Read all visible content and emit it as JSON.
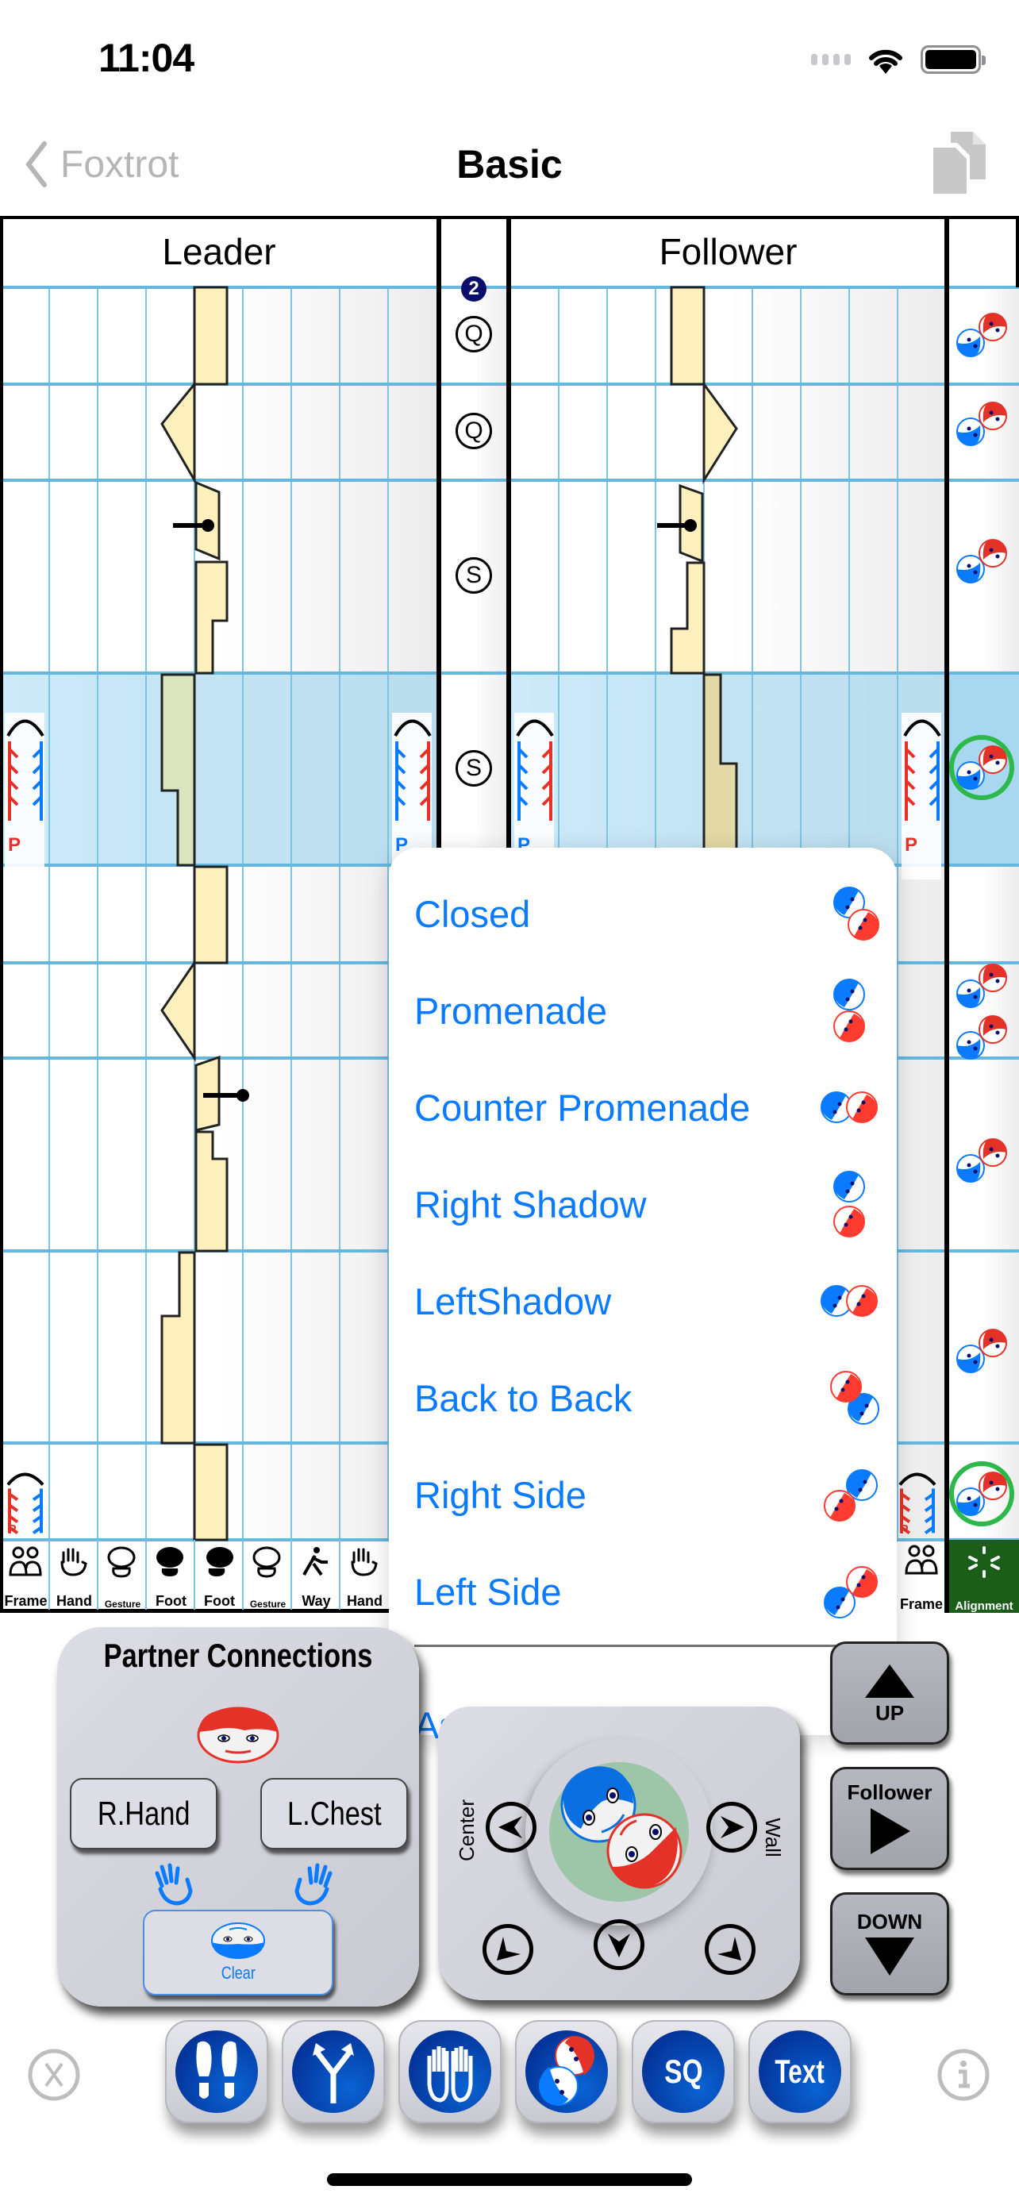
{
  "status_bar": {
    "time": "11:04",
    "battery_percent": 100
  },
  "nav": {
    "back_label": "Foxtrot",
    "title": "Basic",
    "right_icon": "copy-document-icon"
  },
  "chart": {
    "headers": {
      "leader": "Leader",
      "follower": "Follower"
    },
    "bar_number": "2",
    "counts": [
      "Q",
      "Q",
      "S",
      "S"
    ],
    "leader_icon_row": [
      {
        "label": "Frame",
        "icon": "frame-icon"
      },
      {
        "label": "Hand",
        "icon": "hand-icon"
      },
      {
        "label": "Gesture",
        "icon": "gesture-icon"
      },
      {
        "label": "Foot",
        "icon": "left-foot-icon"
      },
      {
        "label": "Foot",
        "icon": "right-foot-icon"
      },
      {
        "label": "Gesture",
        "icon": "gesture-icon"
      },
      {
        "label": "Way",
        "icon": "walking-icon"
      },
      {
        "label": "Hand",
        "icon": "hand-icon"
      }
    ],
    "follower_icon_row": [
      {
        "label": "Frame",
        "icon": "frame-icon"
      },
      {
        "label": "Alignment",
        "icon": "alignment-icon"
      }
    ],
    "frame_marker": "P",
    "colors": {
      "grid": "#7cc4e4",
      "step_fill": "#fdf0bd",
      "highlight_row": "#cdeaf9",
      "alignment_active": "#1a5e1a"
    }
  },
  "popover": {
    "items": [
      {
        "label": "Closed",
        "icon": "closed-position-icon"
      },
      {
        "label": "Promenade",
        "icon": "promenade-position-icon"
      },
      {
        "label": "Counter Promenade",
        "icon": "counter-promenade-position-icon"
      },
      {
        "label": "Right Shadow",
        "icon": "right-shadow-position-icon"
      },
      {
        "label": "LeftShadow",
        "icon": "left-shadow-position-icon"
      },
      {
        "label": "Back to Back",
        "icon": "back-to-back-position-icon"
      },
      {
        "label": "Right Side",
        "icon": "right-side-position-icon"
      },
      {
        "label": "Left Side",
        "icon": "left-side-position-icon"
      }
    ],
    "footer_item": "As Danced",
    "accent": "#0a7aff"
  },
  "partner_connections": {
    "title": "Partner Connections",
    "right_button": "R.Hand",
    "left_button": "L.Chest",
    "clear_label": "Clear"
  },
  "alignment_pad": {
    "left_label": "Center",
    "right_label": "Wall"
  },
  "side_buttons": {
    "up": "UP",
    "follower": "Follower",
    "down": "DOWN"
  },
  "toolbar": {
    "buttons": [
      {
        "name": "steps",
        "label": ""
      },
      {
        "name": "paths",
        "label": ""
      },
      {
        "name": "hands",
        "label": ""
      },
      {
        "name": "alignment",
        "label": ""
      },
      {
        "name": "sq",
        "label": "SQ"
      },
      {
        "name": "text",
        "label": "Text"
      }
    ]
  }
}
